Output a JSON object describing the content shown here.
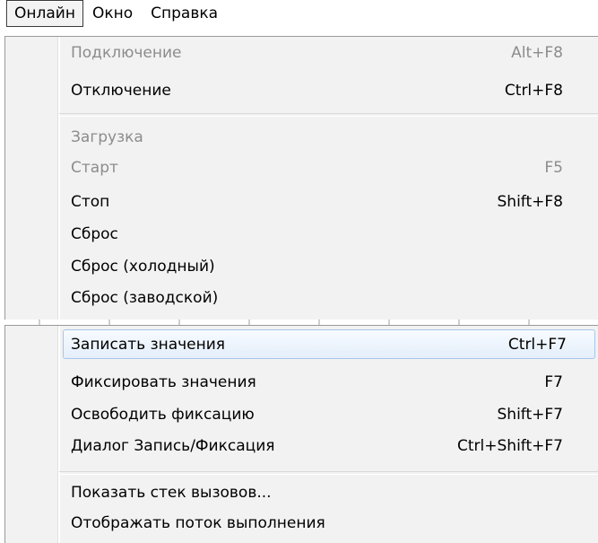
{
  "menubar": {
    "items": [
      "Онлайн",
      "Окно",
      "Справка"
    ]
  },
  "menu_top": {
    "items": [
      {
        "label": "Подключение",
        "shortcut": "Alt+F8",
        "enabled": false
      },
      {
        "label": "Отключение",
        "shortcut": "Ctrl+F8",
        "enabled": true
      },
      {
        "label": "Загрузка",
        "shortcut": "",
        "enabled": false
      },
      {
        "label": "Старт",
        "shortcut": "F5",
        "enabled": false
      },
      {
        "label": "Стоп",
        "shortcut": "Shift+F8",
        "enabled": true
      },
      {
        "label": "Сброс",
        "shortcut": "",
        "enabled": true
      },
      {
        "label": "Сброс (холодный)",
        "shortcut": "",
        "enabled": true
      },
      {
        "label": "Сброс (заводской)",
        "shortcut": "",
        "enabled": true
      }
    ]
  },
  "menu_bottom": {
    "items": [
      {
        "label": "Записать значения",
        "shortcut": "Ctrl+F7",
        "enabled": true,
        "highlighted": true
      },
      {
        "label": "Фиксировать значения",
        "shortcut": "F7",
        "enabled": true
      },
      {
        "label": "Освободить фиксацию",
        "shortcut": "Shift+F7",
        "enabled": true
      },
      {
        "label": "Диалог Запись/Фиксация",
        "shortcut": "Ctrl+Shift+F7",
        "enabled": true
      },
      {
        "label": "Показать стек вызовов...",
        "shortcut": "",
        "enabled": true
      },
      {
        "label": "Отображать поток выполнения",
        "shortcut": "",
        "enabled": true
      }
    ]
  },
  "colors": {
    "disabled_text": "#8c8c8c",
    "highlight_border": "#a9c4e8",
    "menu_background": "#f2f2f2"
  }
}
